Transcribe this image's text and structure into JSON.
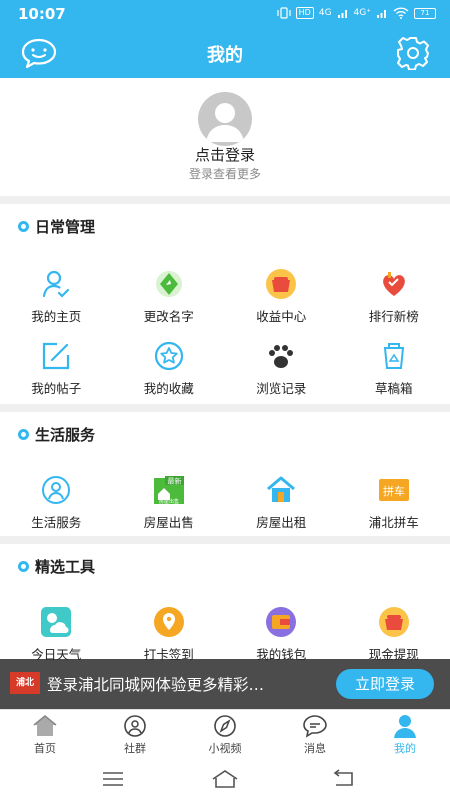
{
  "status_bar": {
    "time": "10:07",
    "hd": "HD",
    "signal1": "4G",
    "signal2": "4G⁺",
    "battery": "71"
  },
  "header": {
    "title": "我的",
    "chat_icon": "chat-bubble-icon",
    "settings_icon": "gear-icon"
  },
  "profile": {
    "login_text": "点击登录",
    "login_sub": "登录查看更多"
  },
  "sections": {
    "daily": {
      "title": "日常管理",
      "items": [
        {
          "label": "我的主页",
          "icon": "person-icon"
        },
        {
          "label": "更改名字",
          "icon": "rename-icon"
        },
        {
          "label": "收益中心",
          "icon": "income-pot-icon"
        },
        {
          "label": "排行新榜",
          "icon": "ranking-heart-icon"
        },
        {
          "label": "我的帖子",
          "icon": "edit-post-icon"
        },
        {
          "label": "我的收藏",
          "icon": "star-icon"
        },
        {
          "label": "浏览记录",
          "icon": "paw-icon"
        },
        {
          "label": "草稿箱",
          "icon": "recycle-bin-icon"
        }
      ]
    },
    "life": {
      "title": "生活服务",
      "items": [
        {
          "label": "生活服务",
          "icon": "service-person-icon"
        },
        {
          "label": "房屋出售",
          "icon": "house-sale-icon",
          "badge": "最新",
          "sub": "房屋出售"
        },
        {
          "label": "房屋出租",
          "icon": "house-rent-icon"
        },
        {
          "label": "浦北拼车",
          "icon": "carpool-icon",
          "sub": "拼车"
        }
      ]
    },
    "tools": {
      "title": "精选工具",
      "items": [
        {
          "label": "今日天气",
          "icon": "weather-icon"
        },
        {
          "label": "打卡签到",
          "icon": "checkin-icon"
        },
        {
          "label": "我的钱包",
          "icon": "wallet-icon"
        },
        {
          "label": "现金提现",
          "icon": "cash-pot-icon"
        }
      ]
    }
  },
  "banner": {
    "logo": "浦北",
    "text": "登录浦北同城网体验更多精彩…",
    "button": "立即登录"
  },
  "tabbar": [
    {
      "label": "首页",
      "icon": "home-icon"
    },
    {
      "label": "社群",
      "icon": "community-icon"
    },
    {
      "label": "小视频",
      "icon": "compass-icon"
    },
    {
      "label": "消息",
      "icon": "message-icon"
    },
    {
      "label": "我的",
      "icon": "profile-icon",
      "active": true
    }
  ],
  "colors": {
    "accent": "#34b6ee",
    "orange": "#f5a623",
    "green": "#4cbb3c",
    "red": "#e94b3c"
  }
}
